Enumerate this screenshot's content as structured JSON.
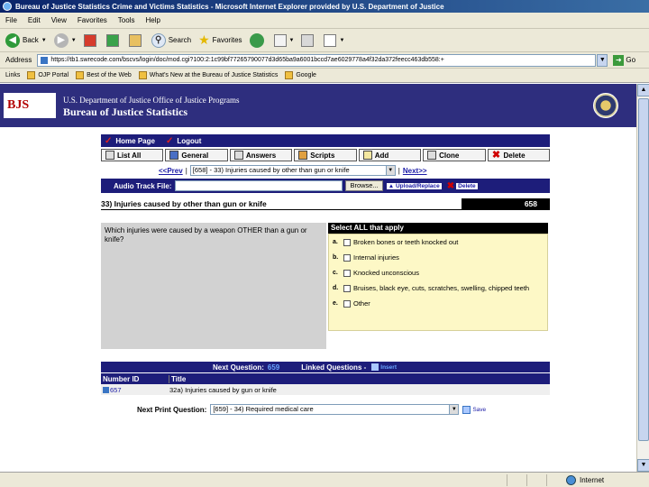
{
  "browser": {
    "window_title": "Bureau of Justice Statistics Crime and Victims Statistics - Microsoft Internet Explorer provided by U.S. Department of Justice",
    "menu": [
      "File",
      "Edit",
      "View",
      "Favorites",
      "Tools",
      "Help"
    ],
    "toolbar": {
      "back_label": "Back",
      "search_label": "Search",
      "favorites_label": "Favorites"
    },
    "address_label": "Address",
    "address_url": "https://tb1.swrecode.com/bscvs/login/doc/mod.cgi?100:2:1c99bf77265790077d3d65ba9a6001bccd7ae6029778a4f32da372feecc463db558:+",
    "go_label": "Go",
    "links_label": "Links",
    "links": [
      "OJP Portal",
      "Best of the Web",
      "What's New at the Bureau of Justice Statistics",
      "Google"
    ],
    "status_zone": "Internet"
  },
  "banner": {
    "logo_text": "BJS",
    "department": "U.S. Department of Justice Office of Justice Programs",
    "bureau": "Bureau of Justice Statistics"
  },
  "nav": {
    "home_label": "Home Page",
    "logout_label": "Logout"
  },
  "buttons": {
    "list_all": "List All",
    "general": "General",
    "answers": "Answers",
    "scripts": "Scripts",
    "add": "Add",
    "clone": "Clone",
    "delete": "Delete"
  },
  "pager": {
    "prev_label": "<<Prev",
    "separator_left": "|",
    "current_question": "[658] - 33) Injuries caused by other than gun or knife",
    "separator_right": "|",
    "next_label": "Next>>"
  },
  "audio": {
    "label": "Audio Track File:",
    "browse_label": "Browse...",
    "upload_label": "Upload/Replace",
    "delete_label": "Delete"
  },
  "question": {
    "title": "33) Injuries caused by other than gun or knife",
    "number": "658",
    "text": "Which injuries were caused by a weapon OTHER than a gun or knife?",
    "answers_header": "Select ALL that apply",
    "answers": [
      {
        "letter": "a.",
        "text": "Broken bones or teeth knocked out"
      },
      {
        "letter": "b.",
        "text": "Internal injuries"
      },
      {
        "letter": "c.",
        "text": "Knocked unconscious"
      },
      {
        "letter": "d.",
        "text": "Bruises, black eye, cuts, scratches, swelling, chipped teeth"
      },
      {
        "letter": "e.",
        "text": "Other"
      }
    ]
  },
  "next_question": {
    "label": "Next Question:",
    "number": "659",
    "linked_label": "Linked Questions -",
    "insert_label": "Insert"
  },
  "linked_table": {
    "headers": [
      "Number ID",
      "Title"
    ],
    "rows": [
      {
        "id": "657",
        "title": "32a) Injuries caused by gun or knife"
      }
    ]
  },
  "next_print": {
    "label": "Next Print Question:",
    "value": "[659] - 34) Required medical care",
    "save_label": "Save"
  }
}
